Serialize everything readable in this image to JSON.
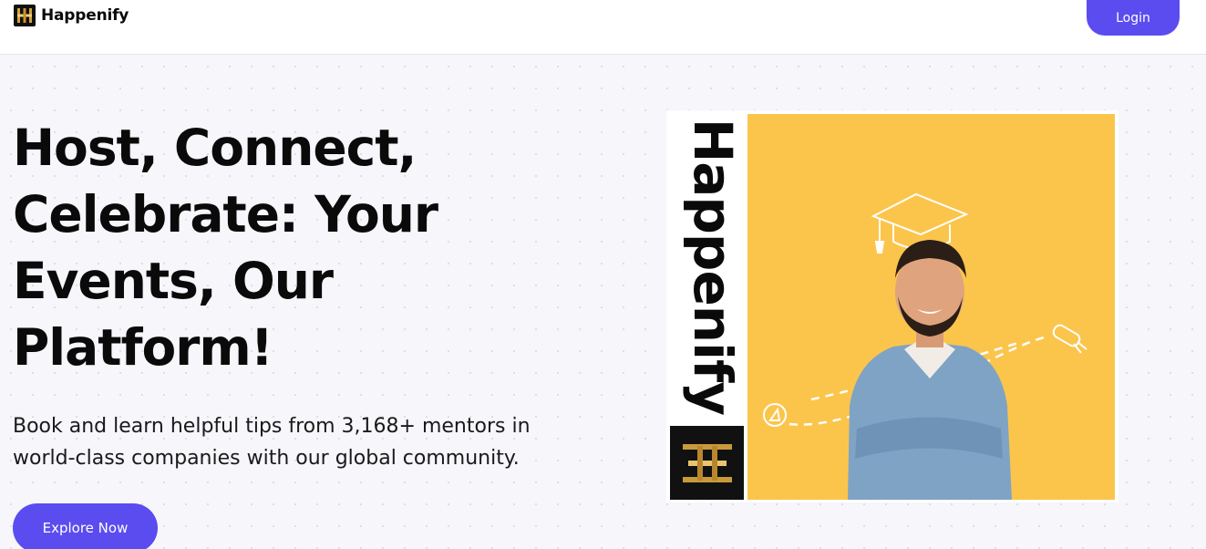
{
  "header": {
    "brand_name": "Happenify",
    "login_label": "Login"
  },
  "hero": {
    "headline_lines": [
      "Host, Connect,",
      "Celebrate: Your",
      "Events, Our",
      "Platform!"
    ],
    "subtext_lines": [
      "Book and learn helpful tips from 3,168+ mentors in",
      "world-class companies with our global community."
    ],
    "cta_label": "Explore Now"
  },
  "promo_image": {
    "brand_vertical": "Happenify",
    "background_color": "#fbc54c",
    "icons": [
      "graduation-cap-icon",
      "diploma-scroll-icon",
      "compass-icon"
    ]
  },
  "colors": {
    "accent": "#5b4cf0",
    "page_background": "#f6f6fb",
    "promo_yellow": "#fbc54c"
  }
}
